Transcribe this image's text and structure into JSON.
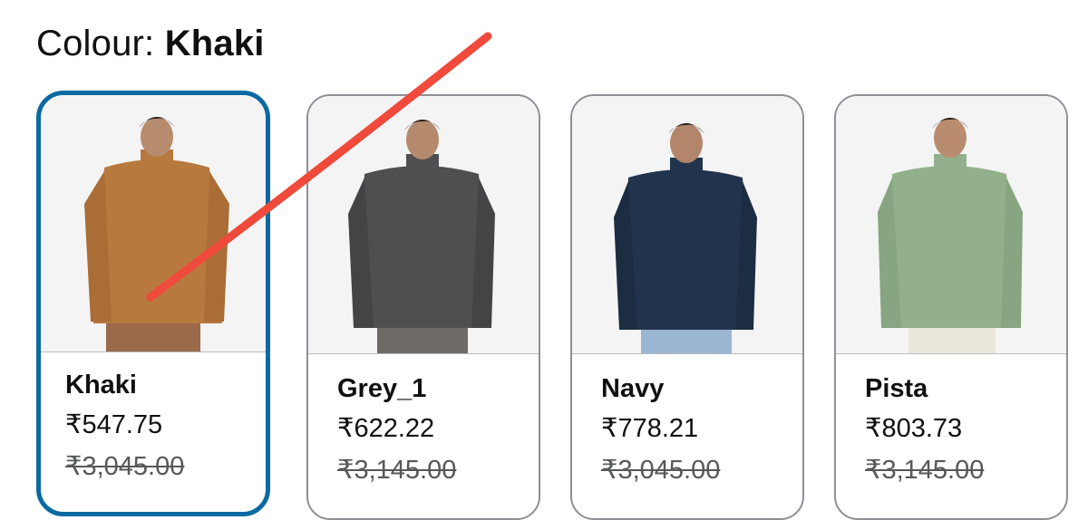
{
  "colour_selector": {
    "label": "Colour:",
    "selected": "Khaki"
  },
  "swatches": [
    {
      "name": "Khaki",
      "price": "₹547.75",
      "mrp": "₹3,045.00",
      "color": "#b7793e",
      "pants": "#9a6a4a",
      "selected": true
    },
    {
      "name": "Grey_1",
      "price": "₹622.22",
      "mrp": "₹3,145.00",
      "color": "#4f4f52",
      "pants": "#6e6a66",
      "selected": false
    },
    {
      "name": "Navy",
      "price": "₹778.21",
      "mrp": "₹3,045.00",
      "color": "#22344d",
      "pants": "#9bb6d3",
      "selected": false
    },
    {
      "name": "Pista",
      "price": "₹803.73",
      "mrp": "₹3,145.00",
      "color": "#93b08c",
      "pants": "#ebe6da",
      "selected": false
    }
  ],
  "colors": {
    "selected_border": "#0a6aa1",
    "card_border": "#8d9096",
    "annotation_stroke": "#ef4a3b"
  }
}
